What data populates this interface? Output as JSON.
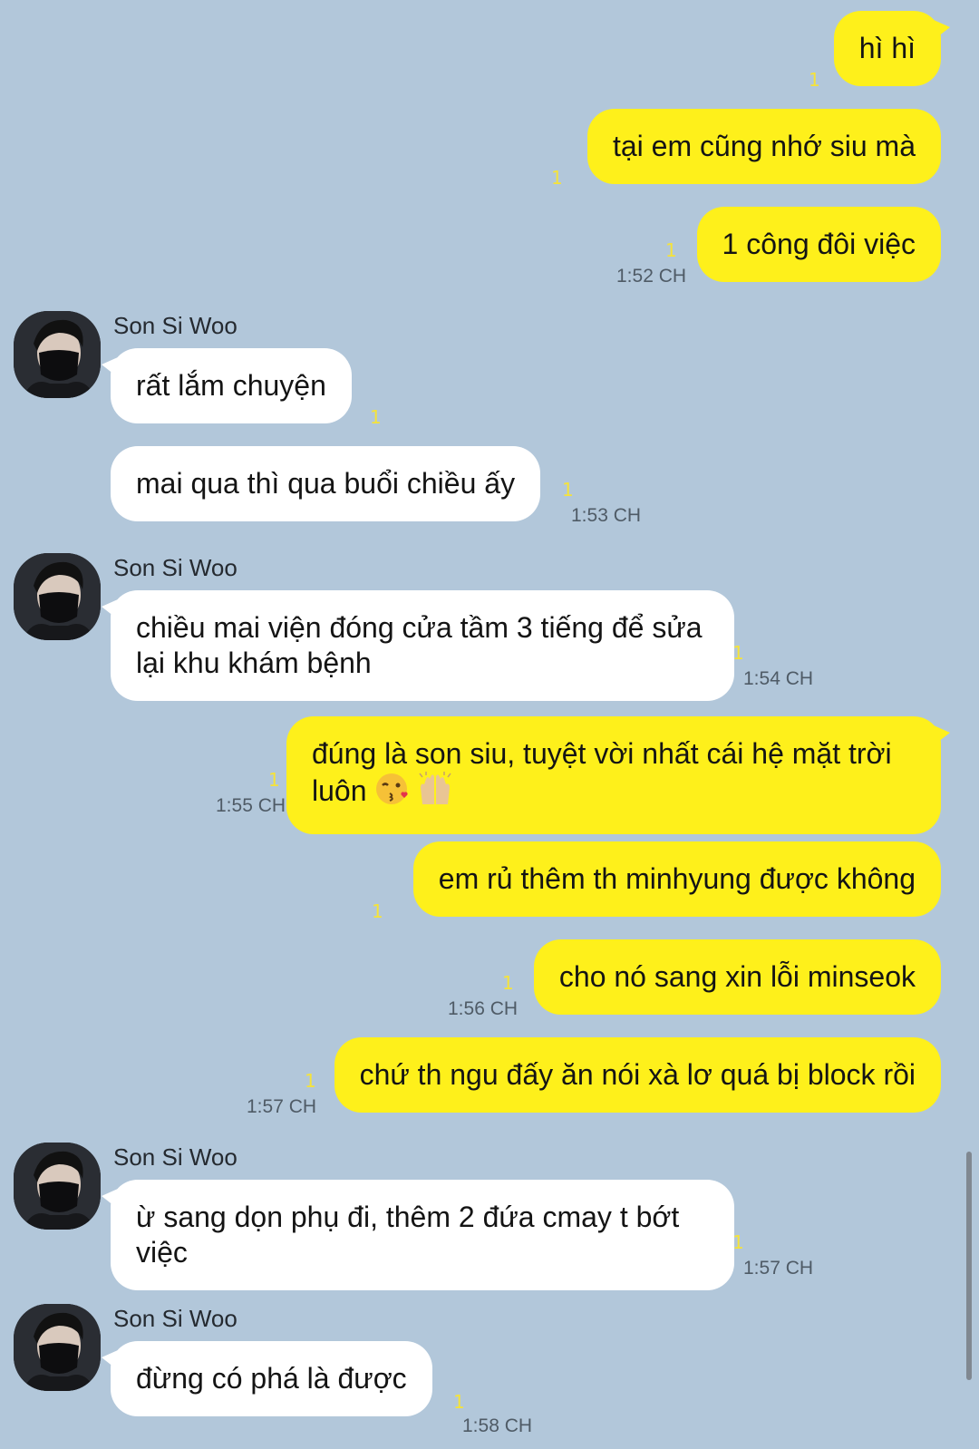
{
  "messages": [
    {
      "from": "me",
      "text": "hì hì",
      "read": "1"
    },
    {
      "from": "me",
      "text": "tại em cũng nhớ siu mà",
      "read": "1"
    },
    {
      "from": "me",
      "text": "1 công đôi việc",
      "read": "1",
      "time": "1:52 CH"
    },
    {
      "from": "other",
      "sender": "Son Si Woo",
      "text": "rất lắm chuyện",
      "read": "1"
    },
    {
      "from": "other",
      "text": "mai qua thì qua buổi chiều ấy",
      "read": "1",
      "time": "1:53 CH"
    },
    {
      "from": "other",
      "sender": "Son Si Woo",
      "text": "chiều mai viện đóng cửa tầm 3 tiếng để sửa lại khu khám bệnh",
      "read": "1",
      "time": "1:54 CH"
    },
    {
      "from": "me",
      "text": "đúng là son siu, tuyệt vời nhất cái hệ mặt trời luôn",
      "emojis": [
        "kiss-wink-emoji",
        "raising-hands-emoji"
      ],
      "read": "1",
      "time": "1:55 CH"
    },
    {
      "from": "me",
      "text": "em rủ thêm th minhyung được không",
      "read": "1"
    },
    {
      "from": "me",
      "text": "cho nó sang xin lỗi minseok",
      "read": "1",
      "time": "1:56 CH"
    },
    {
      "from": "me",
      "text": "chứ th ngu đấy ăn nói xà lơ quá bị block rồi",
      "read": "1",
      "time": "1:57 CH"
    },
    {
      "from": "other",
      "sender": "Son Si Woo",
      "text": "ừ sang dọn phụ đi, thêm 2 đứa cmay t bớt việc",
      "read": "1",
      "time": "1:57 CH"
    },
    {
      "from": "other",
      "sender": "Son Si Woo",
      "text": "đừng có phá là được",
      "read": "1",
      "time": "1:58 CH"
    }
  ],
  "colors": {
    "background": "#b2c7da",
    "my_bubble": "#fef01b",
    "their_bubble": "#ffffff",
    "unread": "#f5e33a",
    "time": "#4f5b66"
  }
}
